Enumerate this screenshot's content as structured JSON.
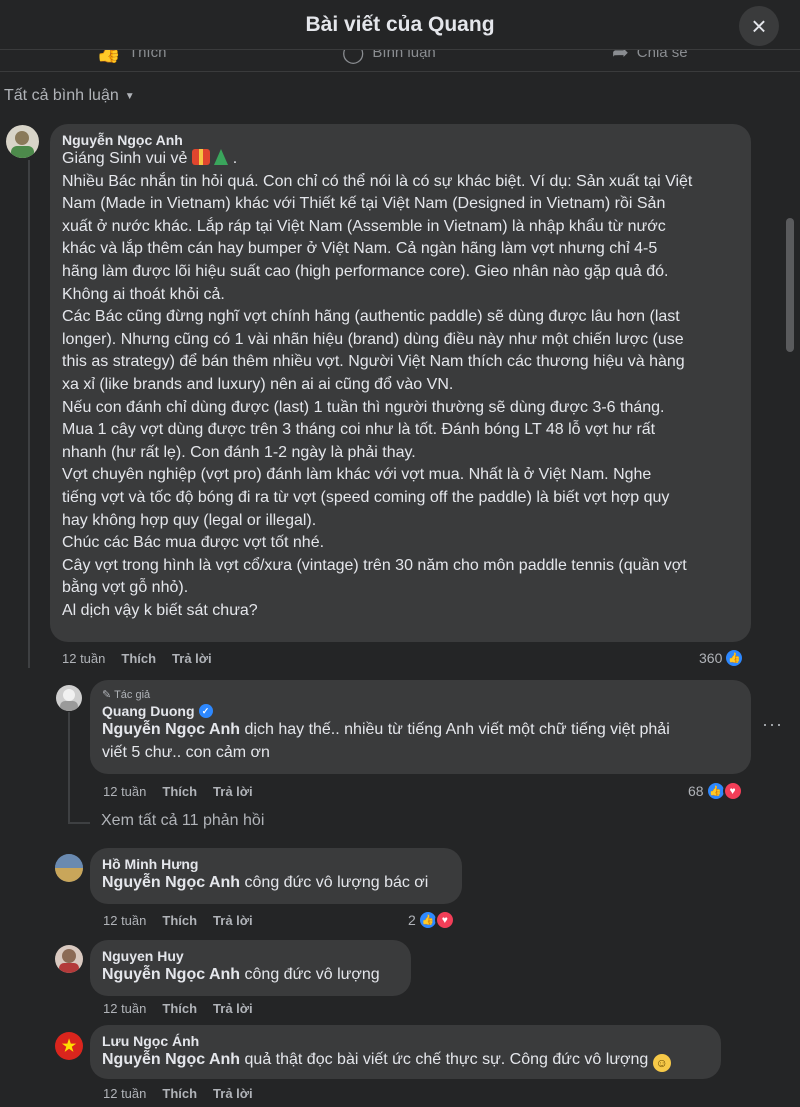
{
  "header": {
    "title": "Bài viết của Quang",
    "close_icon": "×"
  },
  "actions": [
    {
      "label": "Thích",
      "icon": "like-icon"
    },
    {
      "label": "Bình luận",
      "icon": "comment-icon"
    },
    {
      "label": "Chia sẻ",
      "icon": "share-icon"
    }
  ],
  "filter": {
    "label": "Tất cả bình luận"
  },
  "comments": {
    "c1": {
      "author": "Nguyễn Ngọc Anh",
      "greeting": "Giáng Sinh vui vẻ",
      "lines": [
        "Nhiều Bác nhắn tin hỏi quá. Con chỉ có thể nói là có sự khác biệt. Ví dụ: Sản xuất tại Việt",
        "Nam (Made in Vietnam) khác với Thiết kế tại Việt Nam (Designed in Vietnam) rồi Sản",
        "xuất ở nước khác. Lắp ráp tại Việt Nam (Assemble in Vietnam) là nhập khẩu từ nước",
        "khác và lắp thêm cán hay bumper ở Việt Nam. Cả ngàn hãng làm vợt nhưng chỉ 4-5",
        "hãng làm được lõi hiệu suất cao (high performance core). Gieo nhân nào gặp quả đó.",
        "Không ai thoát khỏi cả.",
        "Các Bác cũng đừng nghĩ vợt chính hãng (authentic paddle) sẽ dùng được lâu hơn (last",
        "longer). Nhưng cũng có 1 vài nhãn hiệu (brand) dùng điều này như một chiến lược (use",
        "this as strategy) để bán thêm nhiều vợt. Người Việt Nam thích các thương hiệu và hàng",
        "xa xỉ (like brands and luxury) nên ai ai cũng đổ vào VN.",
        "Nếu con đánh chỉ dùng được (last) 1 tuần thì người thường sẽ dùng được 3-6 tháng.",
        "Mua 1 cây vợt dùng được trên 3 tháng coi như là tốt. Đánh bóng LT 48 lỗ vợt hư rất",
        "nhanh (hư rất lẹ). Con đánh 1-2 ngày là phải thay.",
        "Vợt chuyên nghiệp (vợt pro) đánh làm khác với vợt mua. Nhất là ở Việt Nam. Nghe",
        "tiếng vợt và tốc độ bóng đi ra từ vợt (speed coming off the paddle) là biết vợt hợp quy",
        "hay không hợp quy (legal or illegal).",
        "Chúc các Bác mua được vợt tốt nhé.",
        "Cây vợt trong hình là vợt cổ/xưa (vintage) trên 30 năm cho môn paddle tennis (quần vợt",
        "bằng vợt gỗ nhỏ).",
        "Al dịch vậy k biết sát chưa?"
      ],
      "time": "12 tuần",
      "like": "Thích",
      "reply": "Trả lời",
      "reactions": "360"
    },
    "c2": {
      "tag": "Tác giả",
      "author": "Quang Duong",
      "mention": "Nguyễn Ngọc Anh",
      "line1": " dịch hay thế.. nhiều từ tiếng Anh viết một chữ tiếng việt phải",
      "line2": "viết 5 chư.. con cảm ơn",
      "time": "12 tuần",
      "like": "Thích",
      "reply": "Trả lời",
      "reactions": "68"
    },
    "see_all": "Xem tất cả 11 phản hồi",
    "c3": {
      "author": "Hồ Minh Hưng",
      "mention": "Nguyễn Ngọc Anh",
      "text": " công đức vô lượng bác ơi",
      "time": "12 tuần",
      "like": "Thích",
      "reply": "Trả lời",
      "reactions": "2"
    },
    "c4": {
      "author": "Nguyen Huy",
      "mention": "Nguyễn Ngọc Anh",
      "text": " công đức vô lượng",
      "time": "12 tuần",
      "like": "Thích",
      "reply": "Trả lời"
    },
    "c5": {
      "author": "Lưu Ngọc Ánh",
      "mention": "Nguyễn Ngọc Anh",
      "text": " quả thật đọc bài viết ức chế thực sự. Công đức vô lượng",
      "time": "12 tuần",
      "like": "Thích",
      "reply": "Trả lời"
    }
  },
  "more_menu": "···",
  "colors": {
    "background": "#242526",
    "bubble": "#3a3b3c",
    "like": "#2d88ff",
    "love": "#f33e58"
  }
}
